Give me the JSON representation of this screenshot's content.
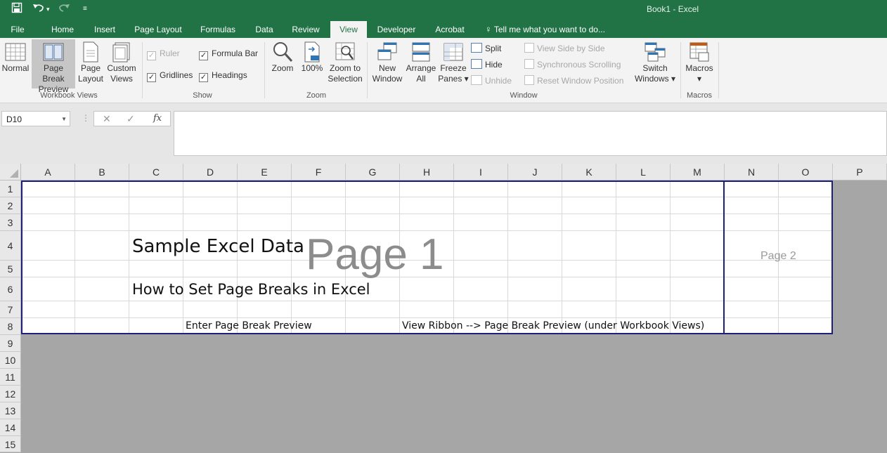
{
  "title_bar": {
    "title": "Book1 - Excel",
    "save_icon": "save-icon",
    "undo_icon": "undo-icon",
    "redo_icon": "redo-icon",
    "customize_icon": "customize-qat-icon"
  },
  "tabs": [
    {
      "label": "File",
      "active": false
    },
    {
      "label": "Home",
      "active": false
    },
    {
      "label": "Insert",
      "active": false
    },
    {
      "label": "Page Layout",
      "active": false
    },
    {
      "label": "Formulas",
      "active": false
    },
    {
      "label": "Data",
      "active": false
    },
    {
      "label": "Review",
      "active": false
    },
    {
      "label": "View",
      "active": true
    },
    {
      "label": "Developer",
      "active": false
    },
    {
      "label": "Acrobat",
      "active": false
    }
  ],
  "tell_me": "Tell me what you want to do...",
  "ribbon": {
    "workbook_views": {
      "group_label": "Workbook Views",
      "normal": [
        "Normal"
      ],
      "page_break_preview": [
        "Page Break",
        "Preview"
      ],
      "page_layout": [
        "Page",
        "Layout"
      ],
      "custom_views": [
        "Custom",
        "Views"
      ]
    },
    "show": {
      "group_label": "Show",
      "ruler": {
        "label": "Ruler",
        "checked": true,
        "enabled": false
      },
      "formula_bar": {
        "label": "Formula Bar",
        "checked": true,
        "enabled": true
      },
      "gridlines": {
        "label": "Gridlines",
        "checked": true,
        "enabled": true
      },
      "headings": {
        "label": "Headings",
        "checked": true,
        "enabled": true
      }
    },
    "zoom": {
      "group_label": "Zoom",
      "zoom": [
        "Zoom"
      ],
      "hundred": [
        "100%"
      ],
      "zoom_to_selection": [
        "Zoom to",
        "Selection"
      ]
    },
    "window": {
      "group_label": "Window",
      "new_window": [
        "New",
        "Window"
      ],
      "arrange_all": [
        "Arrange",
        "All"
      ],
      "freeze_panes": [
        "Freeze",
        "Panes ▾"
      ],
      "split": "Split",
      "hide": "Hide",
      "unhide": "Unhide",
      "view_side_by_side": "View Side by Side",
      "synchronous_scrolling": "Synchronous Scrolling",
      "reset_window_position": "Reset Window Position",
      "switch_windows": [
        "Switch",
        "Windows ▾"
      ]
    },
    "macros": {
      "group_label": "Macros",
      "macros": [
        "Macros",
        "▾"
      ]
    }
  },
  "formula_bar": {
    "name_box": "D10",
    "cancel": "✕",
    "enter": "✓",
    "fx": "fx",
    "formula": ""
  },
  "columns": [
    "A",
    "B",
    "C",
    "D",
    "E",
    "F",
    "G",
    "H",
    "I",
    "J",
    "K",
    "L",
    "M",
    "N",
    "O",
    "P"
  ],
  "rows": [
    "1",
    "2",
    "3",
    "4",
    "5",
    "6",
    "7",
    "8",
    "9",
    "10",
    "11",
    "12",
    "13",
    "14",
    "15"
  ],
  "cells": {
    "C4": "Sample Excel Data",
    "C6": "How to Set Page Breaks in Excel",
    "D8": "Enter Page Break Preview",
    "H8": "View Ribbon --> Page Break Preview (under Workbook Views)"
  },
  "watermarks": {
    "page1": "Page 1",
    "page2": "Page 2"
  }
}
